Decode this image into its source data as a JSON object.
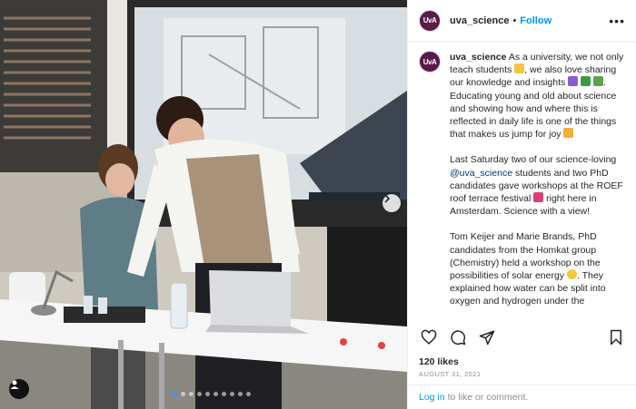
{
  "post": {
    "username": "uva_science",
    "avatar_text": "UvA",
    "header_separator": "•",
    "follow_label": "Follow",
    "more_label": "•••"
  },
  "caption": {
    "p1_text": "As a university, we not only teach students",
    "p1_text2": ", we also love sharing our knowledge and insights",
    "p1_text3": ". Educating young and old about science and showing how and where this is reflected in daily life is one of the things that makes us jump for joy",
    "p2_text1": "Last Saturday two of our science-loving",
    "p2_mention": "@uva_science",
    "p2_text2": "students and two PhD candidates gave workshops at the ROEF roof terrace festival",
    "p2_text3": "right here in Amsterdam. Science with a view!",
    "p3_text1": "Tom Keijer and Marie Brands, PhD candidates from the Homkat group (Chemistry) held a workshop on the possibilities of solar energy",
    "p3_text2": ". They explained how water can be split into oxygen and hydrogen under the"
  },
  "icons": {
    "like": "heart-icon",
    "comment": "comment-icon",
    "share": "share-icon",
    "save": "bookmark-icon",
    "next": "chevron-right-icon",
    "user_tag": "user-icon"
  },
  "stats": {
    "likes": "120 likes",
    "date": "AUGUST 31, 2021"
  },
  "footer": {
    "login_label": "Log in",
    "rest_text": "to like or comment."
  },
  "carousel": {
    "count": 10,
    "active_index": 0
  },
  "colors": {
    "link": "#0095f6",
    "mention": "#00376b",
    "avatar": "#5b1a4a"
  }
}
